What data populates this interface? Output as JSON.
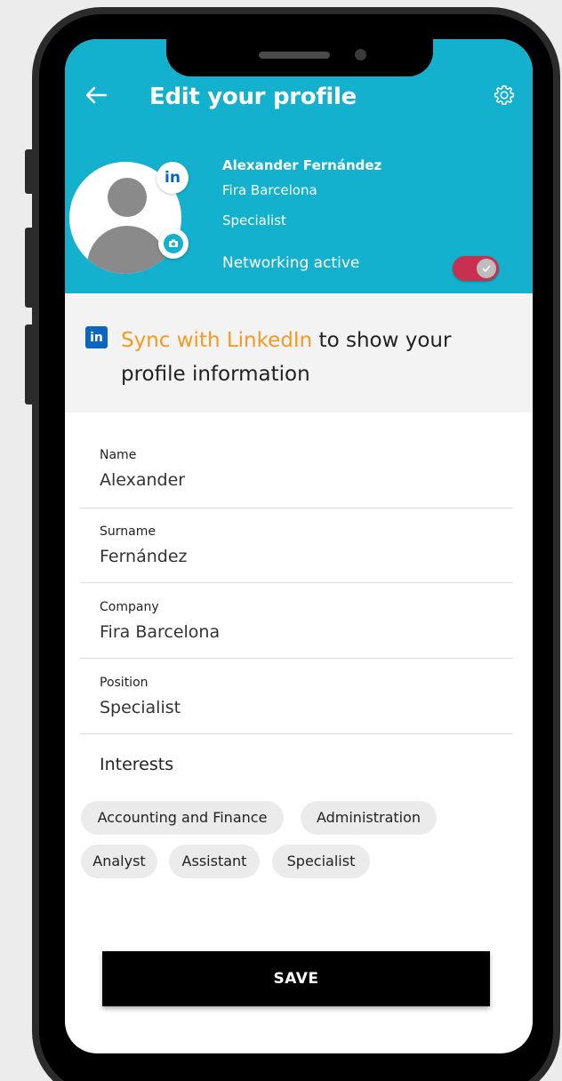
{
  "header": {
    "title": "Edit your profile",
    "background_color": "#13b1cd"
  },
  "profile": {
    "full_name": "Alexander Fernández",
    "company": "Fira Barcelona",
    "position": "Specialist",
    "linkedin_badge": "in",
    "networking_label": "Networking active",
    "networking_on": true,
    "toggle_color": "#c8304f"
  },
  "sync": {
    "icon": "in",
    "link_text": "Sync with LinkedIn",
    "rest_text": " to show your profile information",
    "link_color": "#f39a23"
  },
  "form": {
    "fields": [
      {
        "label": "Name",
        "value": "Alexander"
      },
      {
        "label": "Surname",
        "value": "Fernández"
      },
      {
        "label": "Company",
        "value": "Fira Barcelona"
      },
      {
        "label": "Position",
        "value": "Specialist"
      }
    ],
    "interests_title": "Interests",
    "interests": [
      "Accounting and Finance",
      "Administration",
      "Analyst",
      "Assistant",
      "Specialist"
    ]
  },
  "actions": {
    "save_label": "SAVE"
  }
}
